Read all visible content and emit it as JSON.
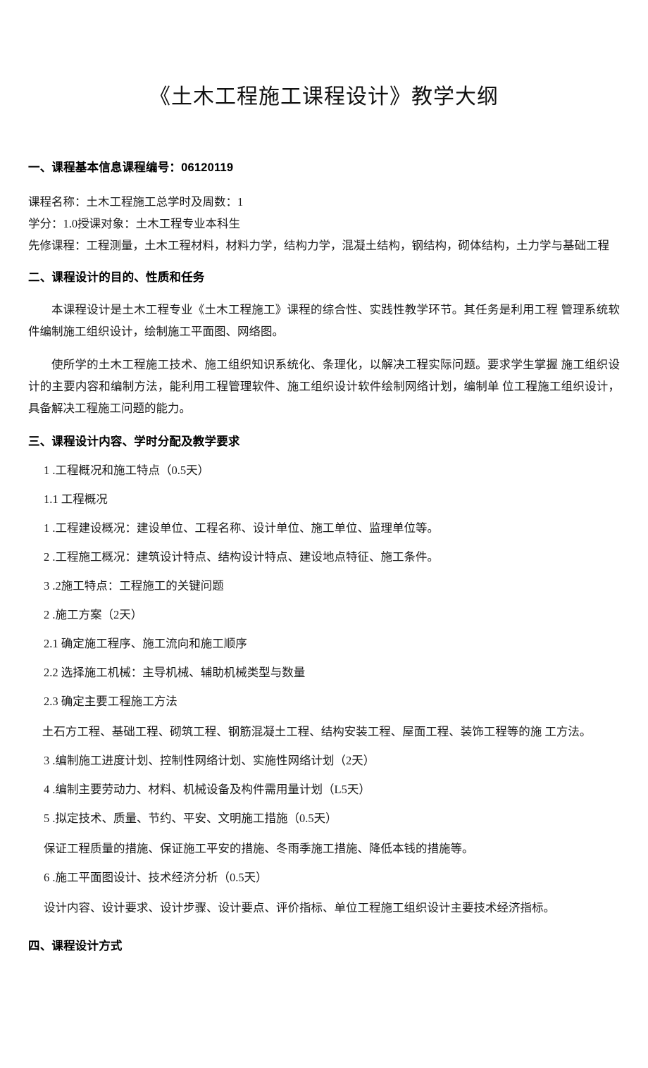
{
  "document": {
    "title": "《土木工程施工课程设计》教学大纲"
  },
  "sections": {
    "one": {
      "heading": "一、课程基本信息课程编号：06120119",
      "lines": [
        "课程名称：土木工程施工总学时及周数：1",
        "学分：1.0授课对象：土木工程专业本科生",
        "先修课程：工程测量，土木工程材料，材料力学，结构力学，混凝土结构，钢结构，砌体结构，土力学与基础工程"
      ]
    },
    "two": {
      "heading": "二、课程设计的目的、性质和任务",
      "paragraphs": [
        "本课程设计是土木工程专业《土木工程施工》课程的综合性、实践性教学环节。其任务是利用工程 管理系统软件编制施工组织设计，绘制施工平面图、网络图。",
        "使所学的土木工程施工技术、施工组织知识系统化、条理化，以解决工程实际问题。要求学生掌握 施工组织设计的主要内容和编制方法，能利用工程管理软件、施工组织设计软件绘制网络计划，编制单 位工程施工组织设计，具备解决工程施工问题的能力。"
      ]
    },
    "three": {
      "heading": "三、课程设计内容、学时分配及教学要求",
      "items": [
        "1 .工程概况和施工特点（0.5天）",
        "1.1  工程概况",
        "1 .工程建设概况：建设单位、工程名称、设计单位、施工单位、监理单位等。",
        "2 .工程施工概况：建筑设计特点、结构设计特点、建设地点特征、施工条件。",
        "3 .2施工特点：工程施工的关键问题",
        "2 .施工方案（2天）",
        "2.1  确定施工程序、施工流向和施工顺序",
        "2.2  选择施工机械：主导机械、辅助机械类型与数量",
        "2.3  确定主要工程施工方法"
      ],
      "flow_paragraph": "土石方工程、基础工程、砌筑工程、钢筋混凝土工程、结构安装工程、屋面工程、装饰工程等的施      工方法。",
      "items_cont": [
        "3 .编制施工进度计划、控制性网络计划、实施性网络计划（2天）",
        "4 .编制主要劳动力、材料、机械设备及构件需用量计划（L5天）",
        "5 .拟定技术、质量、节约、平安、文明施工措施（0.5天）"
      ],
      "note_one": "保证工程质量的措施、保证施工平安的措施、冬雨季施工措施、降低本钱的措施等。",
      "item_six": "6 .施工平面图设计、技术经济分析（0.5天）",
      "note_two": "设计内容、设计要求、设计步骤、设计要点、评价指标、单位工程施工组织设计主要技术经济指标。"
    },
    "four": {
      "heading": "四、课程设计方式"
    }
  }
}
